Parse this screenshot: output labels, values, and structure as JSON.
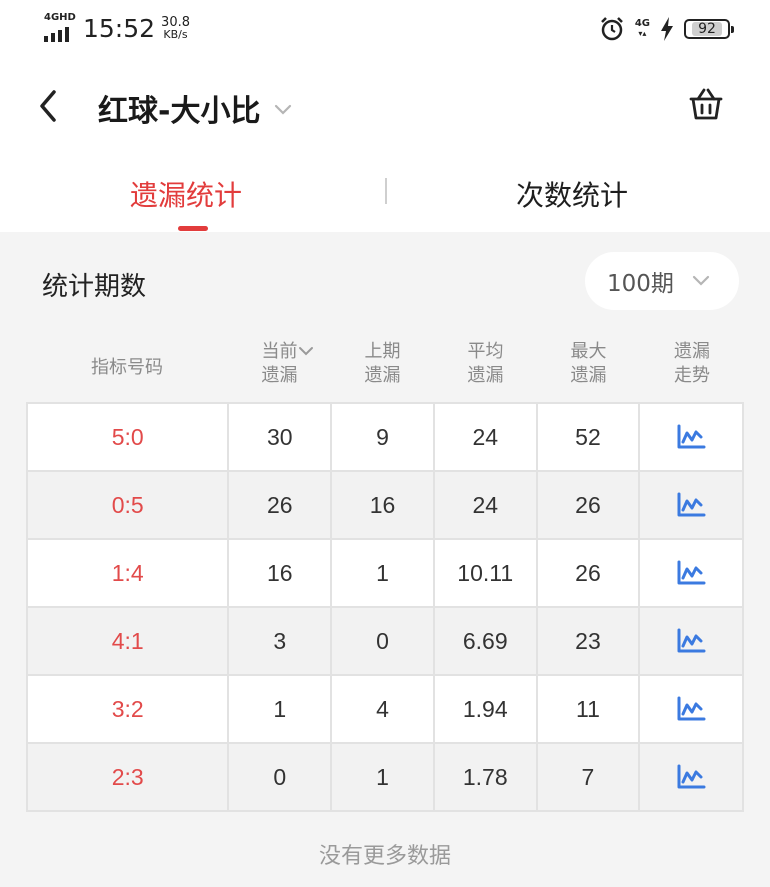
{
  "status_bar": {
    "network_type": "4GHD",
    "time": "15:52",
    "speed_value": "30.8",
    "speed_unit": "KB/s",
    "right_network": "4G",
    "battery": "92"
  },
  "header": {
    "title": "红球-大小比"
  },
  "tabs": [
    {
      "label": "遗漏统计",
      "active": true
    },
    {
      "label": "次数统计",
      "active": false
    }
  ],
  "period": {
    "label": "统计期数",
    "value": "100期"
  },
  "table": {
    "headers": [
      {
        "line1": "指标号码",
        "line2": ""
      },
      {
        "line1": "当前",
        "line2": "遗漏"
      },
      {
        "line1": "上期",
        "line2": "遗漏"
      },
      {
        "line1": "平均",
        "line2": "遗漏"
      },
      {
        "line1": "最大",
        "line2": "遗漏"
      },
      {
        "line1": "遗漏",
        "line2": "走势"
      }
    ],
    "rows": [
      {
        "index": "5:0",
        "current": "30",
        "last": "9",
        "avg": "24",
        "max": "52"
      },
      {
        "index": "0:5",
        "current": "26",
        "last": "16",
        "avg": "24",
        "max": "26"
      },
      {
        "index": "1:4",
        "current": "16",
        "last": "1",
        "avg": "10.11",
        "max": "26"
      },
      {
        "index": "4:1",
        "current": "3",
        "last": "0",
        "avg": "6.69",
        "max": "23"
      },
      {
        "index": "3:2",
        "current": "1",
        "last": "4",
        "avg": "1.94",
        "max": "11"
      },
      {
        "index": "2:3",
        "current": "0",
        "last": "1",
        "avg": "1.78",
        "max": "7"
      }
    ]
  },
  "footer": {
    "note": "没有更多数据"
  },
  "colors": {
    "accent": "#e23c3c",
    "trend_icon": "#3b7ae0"
  }
}
